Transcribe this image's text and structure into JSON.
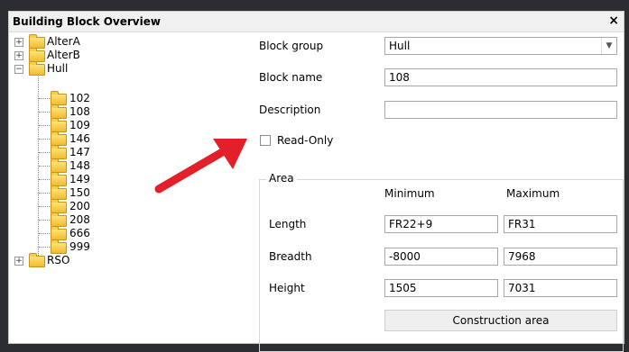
{
  "window": {
    "title": "Building Block Overview",
    "close_glyph": "×"
  },
  "tree": {
    "nodes": [
      {
        "label": "AlterA",
        "expander": "+"
      },
      {
        "label": "AlterB",
        "expander": "+"
      },
      {
        "label": "Hull",
        "expander": "−",
        "children": [
          "102",
          "108",
          "109",
          "146",
          "147",
          "148",
          "149",
          "150",
          "200",
          "208",
          "666",
          "999"
        ],
        "selected_child": "108"
      },
      {
        "label": "RSO",
        "expander": "+"
      }
    ]
  },
  "form": {
    "block_group_label": "Block group",
    "block_group_value": "Hull",
    "block_name_label": "Block name",
    "block_name_value": "108",
    "description_label": "Description",
    "description_value": "",
    "readonly_label": "Read-Only",
    "readonly_checked": false
  },
  "area": {
    "legend": "Area",
    "min_header": "Minimum",
    "max_header": "Maximum",
    "rows": [
      {
        "label": "Length",
        "min": "FR22+9",
        "max": "FR31"
      },
      {
        "label": "Breadth",
        "min": "-8000",
        "max": "7968"
      },
      {
        "label": "Height",
        "min": "1505",
        "max": "7031"
      }
    ],
    "button_label": "Construction area"
  },
  "annotation": {
    "arrow_color": "#e3202a"
  }
}
